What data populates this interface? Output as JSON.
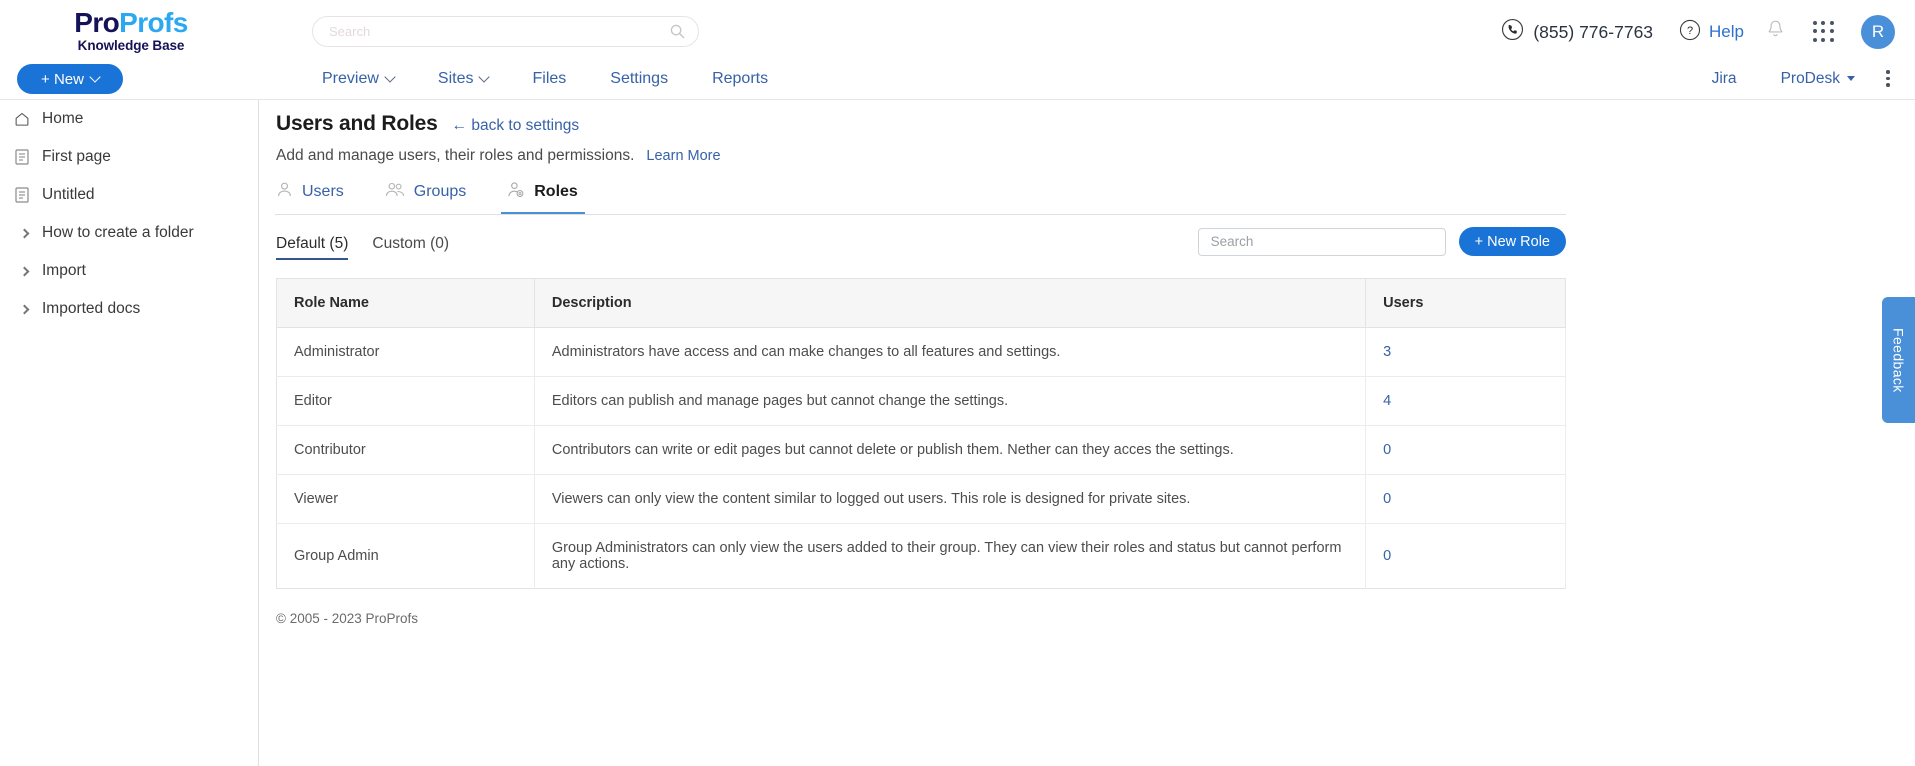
{
  "brand": {
    "logo_part1": "Pro",
    "logo_part2": "Profs",
    "logo_subtitle": "Knowledge Base",
    "color_navy": "#151257",
    "color_cyan": "#2aa8f2",
    "color_primary_blue": "#1a73d6",
    "color_link_blue": "#3762a8",
    "color_accent_blue": "#4a90d9"
  },
  "topbar": {
    "search_placeholder": "Search",
    "search_value": "",
    "phone": "(855) 776-7763",
    "help_label": "Help",
    "avatar_initial": "R",
    "icons": {
      "search": "search-icon",
      "phone": "phone-icon",
      "help": "question-circle-icon",
      "bell": "notification-bell-icon",
      "apps": "apps-grid-icon"
    }
  },
  "navbar": {
    "left_items": [
      {
        "label": "Preview",
        "has_dropdown": true
      },
      {
        "label": "Sites",
        "has_dropdown": true
      },
      {
        "label": "Files",
        "has_dropdown": false
      },
      {
        "label": "Settings",
        "has_dropdown": false
      },
      {
        "label": "Reports",
        "has_dropdown": false
      }
    ],
    "right_items": [
      {
        "label": "Jira",
        "has_dropdown": false
      },
      {
        "label": "ProDesk",
        "has_dropdown": true
      }
    ],
    "more_menu": "kebab-menu-icon"
  },
  "sidebar": {
    "new_button": "+ New",
    "items": [
      {
        "label": "Home",
        "icon": "home-icon"
      },
      {
        "label": "First page",
        "icon": "document-icon"
      },
      {
        "label": "Untitled",
        "icon": "document-icon"
      },
      {
        "label": "How to create a folder",
        "icon": "chevron-right-icon"
      },
      {
        "label": "Import",
        "icon": "chevron-right-icon"
      },
      {
        "label": "Imported docs",
        "icon": "chevron-right-icon"
      }
    ]
  },
  "page": {
    "title": "Users and Roles",
    "back_link": "← back to settings",
    "subtitle": "Add and manage users, their roles and permissions.",
    "learn_more": "Learn More",
    "tabs": [
      {
        "label": "Users",
        "icon": "user-icon",
        "active": false
      },
      {
        "label": "Groups",
        "icon": "users-group-icon",
        "active": false
      },
      {
        "label": "Roles",
        "icon": "user-gear-icon",
        "active": true
      }
    ],
    "subtabs": [
      {
        "label": "Default (5)",
        "active": true
      },
      {
        "label": "Custom (0)",
        "active": false
      }
    ],
    "search_placeholder": "Search",
    "search_value": "",
    "new_role_button": "+ New Role",
    "footer": "© 2005 - 2023 ProProfs"
  },
  "table": {
    "headers": [
      "Role Name",
      "Description",
      "Users"
    ],
    "rows": [
      {
        "name": "Administrator",
        "description": "Administrators have access and can make changes to all features and settings.",
        "users": "3"
      },
      {
        "name": "Editor",
        "description": "Editors can publish and manage pages but cannot change the settings.",
        "users": "4"
      },
      {
        "name": "Contributor",
        "description": "Contributors can write or edit pages but cannot delete or publish them. Nether can they acces the settings.",
        "users": "0"
      },
      {
        "name": "Viewer",
        "description": "Viewers can only view the content similar to logged out users. This role is designed for private sites.",
        "users": "0"
      },
      {
        "name": "Group Admin",
        "description": "Group Administrators can only view the users added to their group. They can view their roles and status but cannot perform any actions.",
        "users": "0"
      }
    ]
  },
  "feedback": {
    "label": "Feedback"
  }
}
